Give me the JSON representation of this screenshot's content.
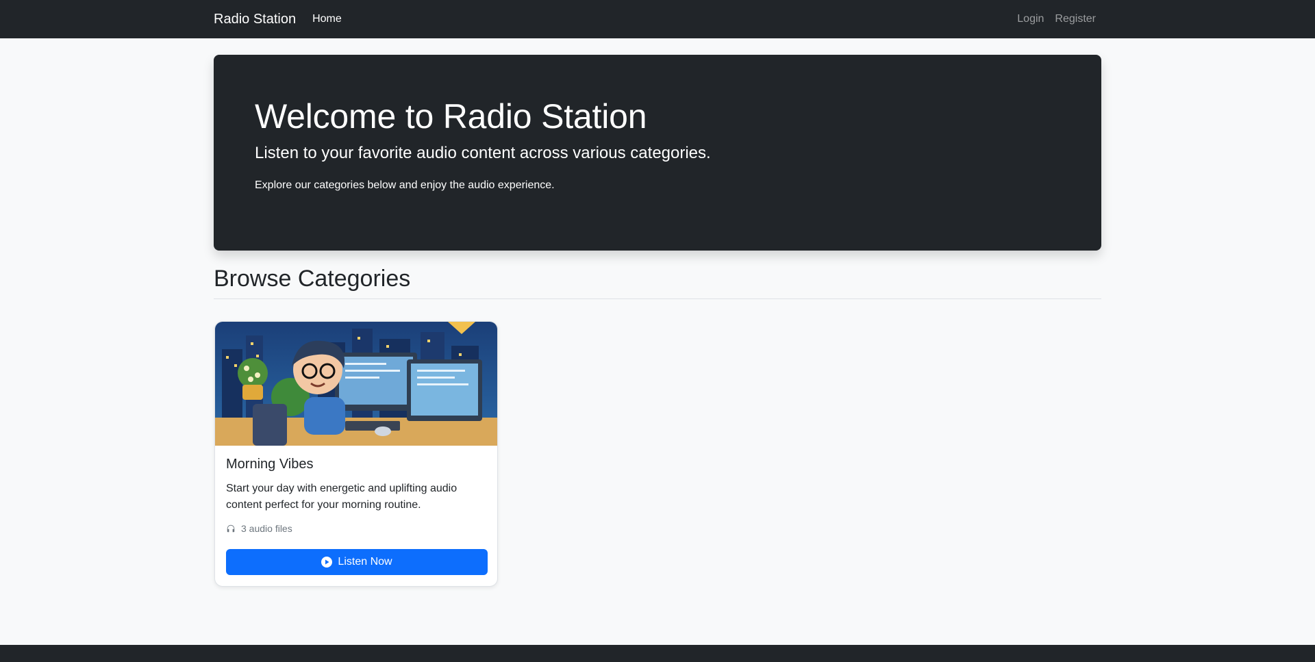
{
  "navbar": {
    "brand": "Radio Station",
    "home": "Home",
    "login": "Login",
    "register": "Register"
  },
  "hero": {
    "title": "Welcome to Radio Station",
    "lead": "Listen to your favorite audio content across various categories.",
    "subtitle": "Explore our categories below and enjoy the audio experience."
  },
  "section": {
    "title": "Browse Categories"
  },
  "categories": [
    {
      "title": "Morning Vibes",
      "description": "Start your day with energetic and uplifting audio content perfect for your morning routine.",
      "count_text": "3 audio files",
      "button_label": "Listen Now",
      "icon": "headphones-icon",
      "button_icon": "play-circle-icon"
    }
  ],
  "colors": {
    "navbar_bg": "#212529",
    "primary": "#0d6efd",
    "page_bg": "#f8f9fa"
  }
}
